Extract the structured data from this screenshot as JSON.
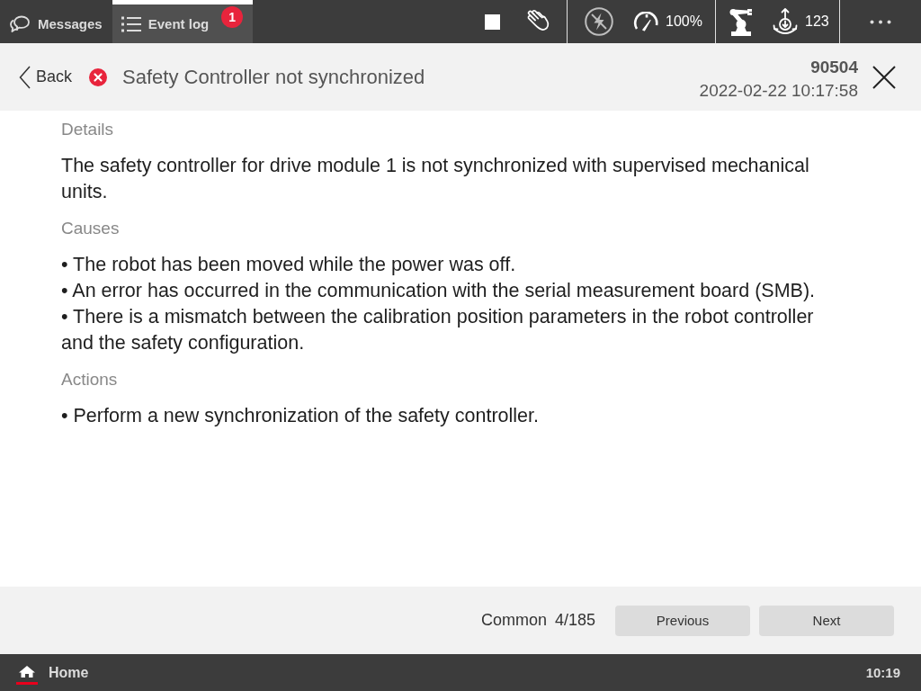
{
  "tabs": [
    {
      "label": "Messages",
      "selected": false
    },
    {
      "label": "Event log",
      "selected": true,
      "badge": "1"
    }
  ],
  "status_bar": {
    "speed": "100%",
    "increment": "123"
  },
  "event": {
    "back": "Back",
    "kind": "error",
    "title": "Safety Controller not synchronized",
    "code": "90504",
    "timestamp": "2022-02-22 10:17:58"
  },
  "sections": [
    {
      "heading": "Details",
      "lines": [
        "The safety controller for drive module 1 is not synchronized with supervised mechanical units."
      ]
    },
    {
      "heading": "Causes",
      "lines": [
        "• The robot has been moved while the power was off.",
        "• An error has occurred in the communication with the serial measurement board (SMB).",
        "• There is a mismatch between the calibration position parameters in the robot controller and the safety configuration."
      ]
    },
    {
      "heading": "Actions",
      "lines": [
        "• Perform a new synchronization of the safety controller."
      ]
    }
  ],
  "footer": {
    "category": "Common",
    "position": "4/185",
    "buttons": [
      "Previous",
      "Next"
    ]
  },
  "bottom_bar": {
    "home": {
      "label": "Home",
      "selected": true
    },
    "time": "10:19"
  }
}
